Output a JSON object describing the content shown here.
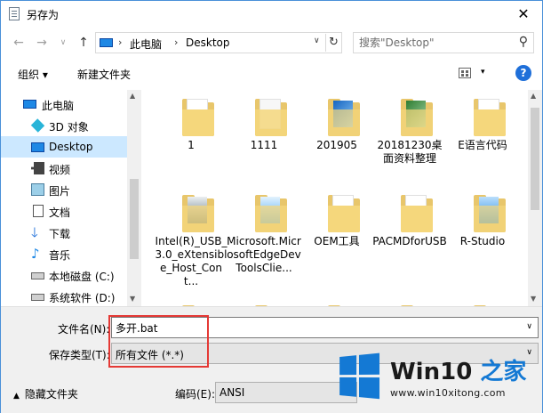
{
  "window": {
    "title": "另存为",
    "close_label": "✕"
  },
  "navigation": {
    "back_glyph": "←",
    "forward_glyph": "→",
    "recent_glyph": "∨",
    "up_glyph": "↑"
  },
  "address": {
    "separator": "›",
    "crumbs": [
      "此电脑",
      "Desktop"
    ],
    "dropdown_glyph": "∨",
    "refresh_glyph": "↻"
  },
  "search": {
    "placeholder": "搜索\"Desktop\"",
    "icon": "search-icon"
  },
  "toolbar": {
    "organize_label": "组织 ▾",
    "new_folder_label": "新建文件夹",
    "view_dropdown_glyph": "▾",
    "help_label": "?"
  },
  "sidebar": {
    "items": [
      {
        "label": "此电脑",
        "icon": "pc-icon"
      },
      {
        "label": "3D 对象",
        "icon": "3d-objects-icon"
      },
      {
        "label": "Desktop",
        "icon": "desktop-icon",
        "selected": true
      },
      {
        "label": "视频",
        "icon": "video-icon"
      },
      {
        "label": "图片",
        "icon": "picture-icon"
      },
      {
        "label": "文档",
        "icon": "document-icon"
      },
      {
        "label": "下载",
        "icon": "download-icon"
      },
      {
        "label": "音乐",
        "icon": "music-icon"
      },
      {
        "label": "本地磁盘 (C:)",
        "icon": "disk-icon"
      },
      {
        "label": "系统软件 (D:)",
        "icon": "disk-icon"
      }
    ]
  },
  "files": {
    "items": [
      {
        "name": "1"
      },
      {
        "name": "1111"
      },
      {
        "name": "201905"
      },
      {
        "name": "20181230桌面资料整理"
      },
      {
        "name": "E语言代码"
      },
      {
        "name": "Intel(R)_USB_3.0_eXtensible_Host_Cont..."
      },
      {
        "name": "Microsoft.MicrosoftEdgeDevToolsClie..."
      },
      {
        "name": "OEM工具"
      },
      {
        "name": "PACMDforUSB"
      },
      {
        "name": "R-Studio"
      },
      {
        "name": ""
      },
      {
        "name": ""
      },
      {
        "name": ""
      },
      {
        "name": ""
      },
      {
        "name": ""
      }
    ]
  },
  "form": {
    "filename_label": "文件名(N):",
    "filename_value": "多开.bat",
    "filetype_label": "保存类型(T):",
    "filetype_value": "所有文件  (*.*)",
    "encoding_label": "编码(E):",
    "encoding_value": "ANSI",
    "hide_folders_label": "隐藏文件夹",
    "dropdown_glyph": "∨"
  },
  "watermark": {
    "title_prefix": "Win10 ",
    "title_suffix": "之家",
    "url": "www.win10xitong.com"
  },
  "colors": {
    "accent": "#1e6fd9",
    "selection": "#cce8ff",
    "highlight_box": "#e53935",
    "folder": "#f5d77c"
  }
}
